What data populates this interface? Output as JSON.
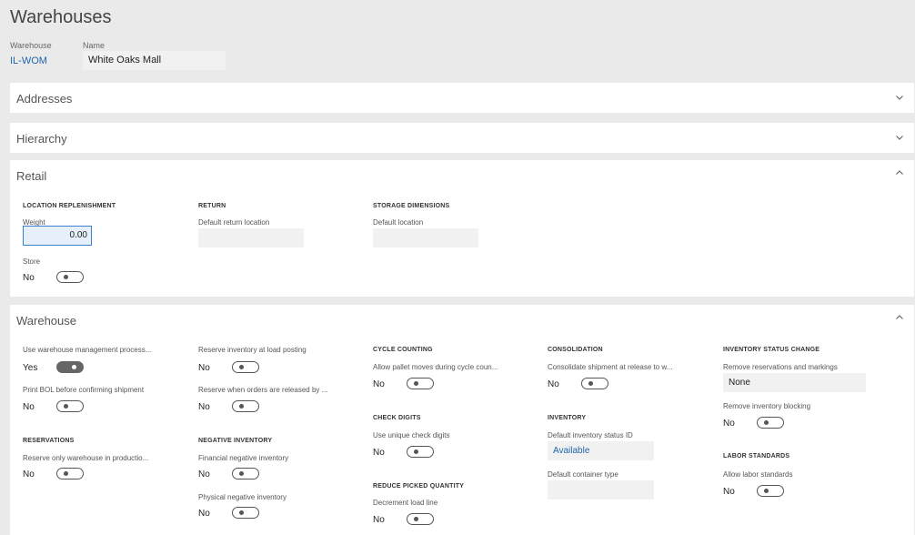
{
  "page": {
    "title": "Warehouses"
  },
  "header": {
    "warehouse_label": "Warehouse",
    "warehouse_value": "IL-WOM",
    "name_label": "Name",
    "name_value": "White Oaks Mall"
  },
  "panels": {
    "addresses": {
      "title": "Addresses",
      "expanded": false
    },
    "hierarchy": {
      "title": "Hierarchy",
      "expanded": false
    },
    "retail": {
      "title": "Retail",
      "expanded": true
    },
    "warehouse": {
      "title": "Warehouse",
      "expanded": true
    }
  },
  "retail": {
    "location_replenishment": {
      "heading": "LOCATION REPLENISHMENT",
      "weight_label": "Weight",
      "weight_value": "0.00",
      "store_label": "Store",
      "store_value": "No",
      "store_on": false
    },
    "return": {
      "heading": "RETURN",
      "default_return_location_label": "Default return location",
      "default_return_location_value": ""
    },
    "storage_dimensions": {
      "heading": "STORAGE DIMENSIONS",
      "default_location_label": "Default location",
      "default_location_value": ""
    }
  },
  "warehouse": {
    "col1": {
      "use_wms_label": "Use warehouse management process...",
      "use_wms_value": "Yes",
      "use_wms_on": true,
      "print_bol_label": "Print BOL before confirming shipment",
      "print_bol_value": "No",
      "reservations_heading": "RESERVATIONS",
      "reserve_only_label": "Reserve only warehouse in productio...",
      "reserve_only_value": "No"
    },
    "col2": {
      "reserve_load_label": "Reserve inventory at load posting",
      "reserve_load_value": "No",
      "reserve_released_label": "Reserve when orders are released by ...",
      "reserve_released_value": "No",
      "negative_inventory_heading": "NEGATIVE INVENTORY",
      "financial_neg_label": "Financial negative inventory",
      "financial_neg_value": "No",
      "physical_neg_label": "Physical negative inventory",
      "physical_neg_value": "No"
    },
    "col3": {
      "cycle_counting_heading": "CYCLE COUNTING",
      "allow_pallet_label": "Allow pallet moves during cycle coun...",
      "allow_pallet_value": "No",
      "check_digits_heading": "CHECK DIGITS",
      "unique_check_label": "Use unique check digits",
      "unique_check_value": "No",
      "reduce_picked_heading": "REDUCE PICKED QUANTITY",
      "decrement_label": "Decrement load line",
      "decrement_value": "No"
    },
    "col4": {
      "consolidation_heading": "CONSOLIDATION",
      "consolidate_label": "Consolidate shipment at release to w...",
      "consolidate_value": "No",
      "inventory_heading": "INVENTORY",
      "default_status_label": "Default inventory status ID",
      "default_status_value": "Available",
      "default_container_label": "Default container type",
      "default_container_value": ""
    },
    "col5": {
      "status_change_heading": "INVENTORY STATUS CHANGE",
      "remove_reservations_label": "Remove reservations and markings",
      "remove_reservations_value": "None",
      "remove_blocking_label": "Remove inventory blocking",
      "remove_blocking_value": "No",
      "labor_heading": "LABOR STANDARDS",
      "allow_labor_label": "Allow labor standards",
      "allow_labor_value": "No"
    }
  },
  "colors": {
    "link": "#2266aa",
    "focus_border": "#3d7fd1",
    "page_bg": "#eaeaea"
  },
  "icons": {
    "expand": "chevron-down-icon",
    "collapse": "chevron-up-icon"
  }
}
